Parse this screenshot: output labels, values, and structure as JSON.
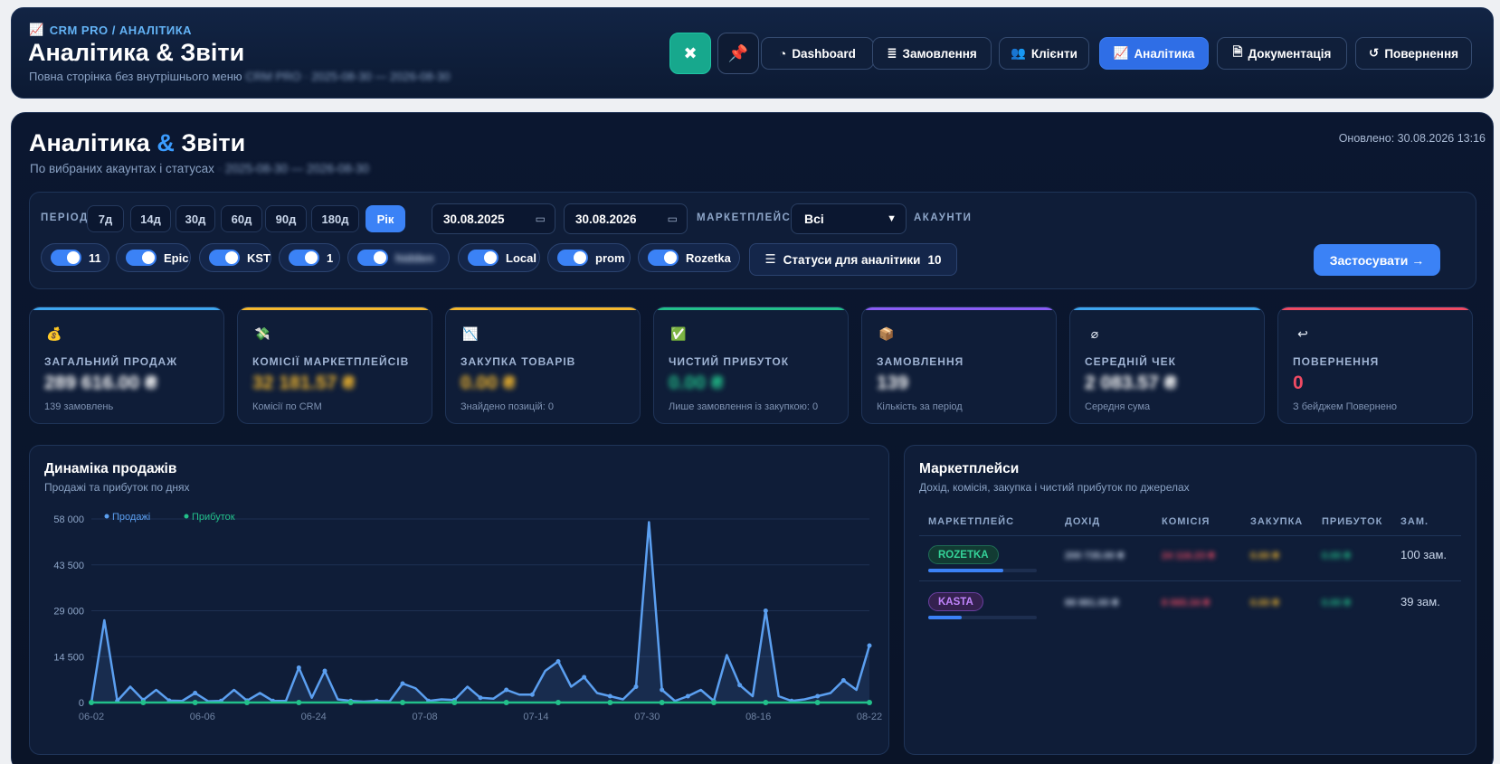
{
  "topbar": {
    "breadcrumb": "CRM PRO / АНАЛІТИКА",
    "title": "Аналітика & Звіти",
    "subtitle": "Повна сторінка без внутрішнього меню",
    "subtitle_meta": "CRM PRO · 2025-08-30 — 2026-08-30",
    "nav": [
      {
        "label": "Dashboard",
        "icon": "gauge-icon"
      },
      {
        "label": "Замовлення",
        "icon": "list-icon"
      },
      {
        "label": "Клієнти",
        "icon": "users-icon"
      },
      {
        "label": "Аналітика",
        "icon": "chart-icon",
        "active": true
      },
      {
        "label": "Документація",
        "icon": "document-icon"
      },
      {
        "label": "Повернення",
        "icon": "undo-icon"
      }
    ]
  },
  "main": {
    "title_a": "Аналітика",
    "title_amp": "&",
    "title_b": "Звіти",
    "subtitle": "По вибраних акаунтах і статусах",
    "subtitle_meta": "· 2025-08-30 — 2026-08-30",
    "updated": "Оновлено: 30.08.2026 13:16"
  },
  "filters": {
    "period_label": "ПЕРІОД",
    "periods": [
      "7д",
      "14д",
      "30д",
      "60д",
      "90д",
      "180д",
      "Рік"
    ],
    "active_period": "Рік",
    "date_from": "30.08.2025",
    "date_to": "30.08.2026",
    "marketplace_label": "МАРКЕТПЛЕЙС",
    "marketplace_value": "Всі",
    "accounts_label": "АКАУНТИ",
    "accounts": [
      "11",
      "Epic",
      "KST",
      "1",
      "hidden",
      "Local",
      "prom",
      "Rozetka"
    ],
    "status_button": "Статуси для аналітики",
    "status_count": "10",
    "apply": "Застосувати →"
  },
  "kpis": [
    {
      "label": "ЗАГАЛЬНИЙ ПРОДАЖ",
      "value": "289 616.00 ₴",
      "note": "139 замовлень",
      "color": "#3ea6f0",
      "icon": "💰"
    },
    {
      "label": "КОМІСІЇ МАРКЕТПЛЕЙСІВ",
      "value": "32 181.57 ₴",
      "note": "Комісії по CRM",
      "color": "#f5b82e",
      "icon": "💸"
    },
    {
      "label": "ЗАКУПКА ТОВАРІВ",
      "value": "0.00 ₴",
      "note": "Знайдено позицій: 0",
      "color": "#f5b82e",
      "icon": "📉"
    },
    {
      "label": "ЧИСТИЙ ПРИБУТОК",
      "value": "0.00 ₴",
      "note": "Лише замовлення із закупкою: 0",
      "color": "#22c08a",
      "icon": "✅"
    },
    {
      "label": "ЗАМОВЛЕННЯ",
      "value": "139",
      "note": "Кількість за період",
      "color": "#8b5cf6",
      "icon": "📦"
    },
    {
      "label": "СЕРЕДНІЙ ЧЕК",
      "value": "2 083.57 ₴",
      "note": "Середня сума",
      "color": "#3ea6f0",
      "icon": "⌀"
    },
    {
      "label": "ПОВЕРНЕННЯ",
      "value": "0",
      "note": "З бейджем Повернено",
      "color": "#ef4a63",
      "icon": "↩"
    }
  ],
  "sales_panel": {
    "title": "Динаміка продажів",
    "subtitle": "Продажі та прибуток по днях"
  },
  "chart_data": {
    "type": "line",
    "title": "Динаміка продажів",
    "xlabel": "",
    "ylabel": "",
    "ylim": [
      0,
      58000
    ],
    "yticks": [
      "58 000",
      "43 500",
      "29 000",
      "14 500",
      "0"
    ],
    "xticks": [
      "06-02",
      "06-06",
      "06-24",
      "07-08",
      "07-14",
      "07-30",
      "08-16",
      "08-22"
    ],
    "legend_position": "top-left",
    "series": [
      {
        "name": "Продажі",
        "color": "#5b9ff0",
        "values": [
          0,
          26000,
          500,
          5000,
          800,
          4000,
          600,
          500,
          3000,
          400,
          500,
          4000,
          600,
          3000,
          500,
          500,
          11000,
          1500,
          10000,
          1000,
          500,
          300,
          500,
          400,
          6000,
          4500,
          500,
          1000,
          800,
          5000,
          1500,
          1200,
          4000,
          2500,
          2500,
          10000,
          13000,
          5000,
          8000,
          3000,
          2000,
          1000,
          5000,
          57000,
          4000,
          500,
          2000,
          4000,
          500,
          15000,
          5500,
          2000,
          29000,
          2000,
          500,
          1000,
          2000,
          3000,
          7000,
          4000,
          18000
        ]
      },
      {
        "name": "Прибуток",
        "color": "#22c08a",
        "values": [
          0,
          0,
          0,
          0,
          0,
          0,
          0,
          0,
          0,
          0,
          0,
          0,
          0,
          0,
          0,
          0,
          0,
          0,
          0,
          0,
          0,
          0,
          0,
          0,
          0,
          0,
          0,
          0,
          0,
          0,
          0,
          0,
          0,
          0,
          0,
          0,
          0,
          0,
          0,
          0,
          0,
          0,
          0,
          0,
          0,
          0,
          0,
          0,
          0,
          0,
          0,
          0,
          0,
          0,
          0,
          0,
          0,
          0,
          0,
          0,
          0
        ]
      }
    ]
  },
  "marketplaces_panel": {
    "title": "Маркетплейси",
    "subtitle": "Дохід, комісія, закупка і чистий прибуток по джерелах",
    "columns": [
      "МАРКЕТПЛЕЙС",
      "ДОХІД",
      "КОМІСІЯ",
      "ЗАКУПКА",
      "ПРИБУТОК",
      "ЗАМ."
    ],
    "rows": [
      {
        "name": "ROZETKA",
        "income": "200 735.00 ₴",
        "commission": "24 116.23 ₴",
        "purchase": "0.00 ₴",
        "profit": "0.00 ₴",
        "orders": "100 зам.",
        "share": 0.69,
        "badge_bg": "#123b33",
        "badge_fg": "#34d399",
        "badge_border": "#1f6b55"
      },
      {
        "name": "KASTA",
        "income": "88 881.00 ₴",
        "commission": "8 065.34 ₴",
        "purchase": "0.00 ₴",
        "profit": "0.00 ₴",
        "orders": "39 зам.",
        "share": 0.31,
        "badge_bg": "#34214f",
        "badge_fg": "#c084fc",
        "badge_border": "#6b3fa0"
      }
    ]
  }
}
